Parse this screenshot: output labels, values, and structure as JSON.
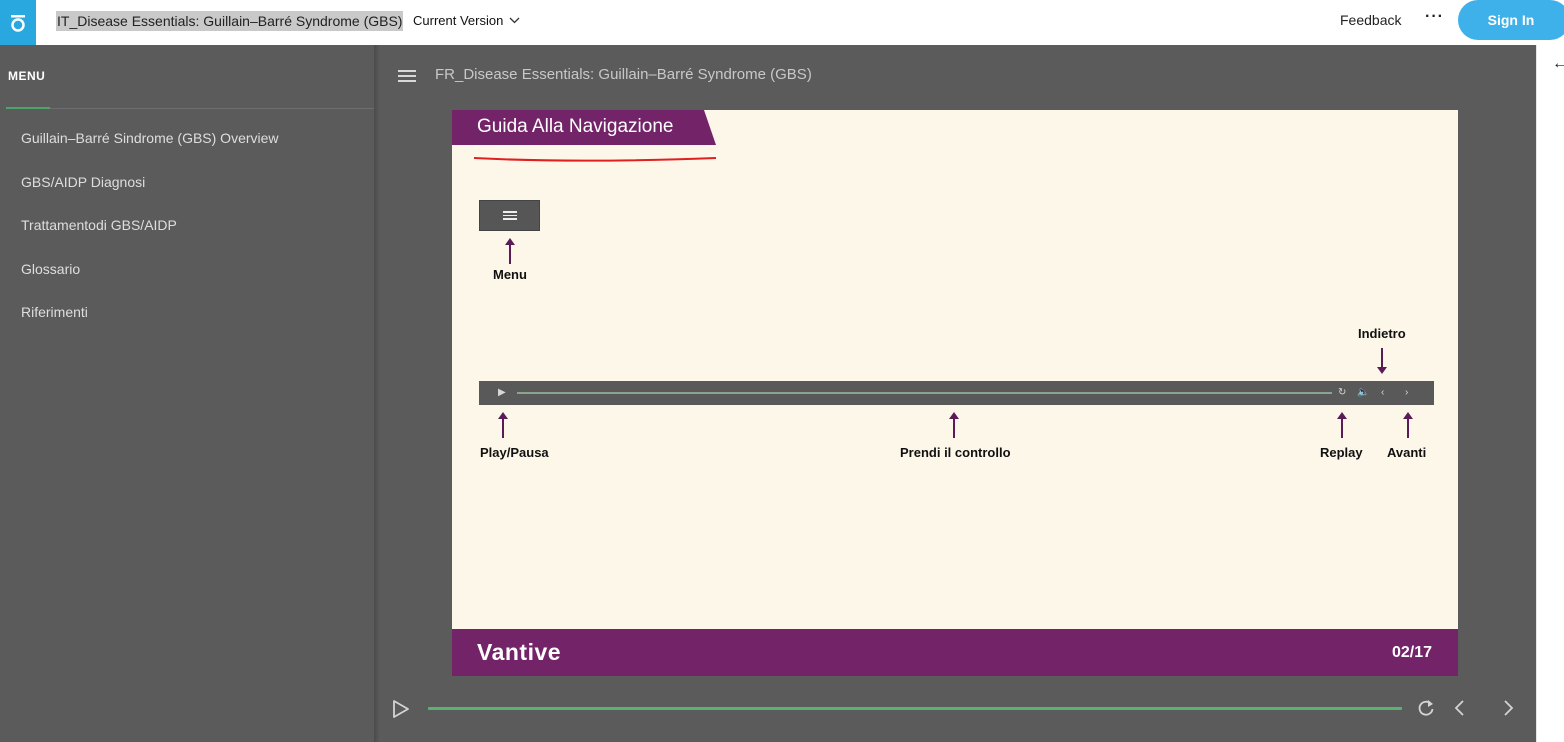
{
  "app": {
    "document_title": "IT_Disease Essentials: Guillain–Barré Syndrome (GBS)",
    "version_label": "Current Version",
    "feedback_label": "Feedback",
    "more_label": "···",
    "signin_label": "Sign In",
    "accent_color": "#29a8e0"
  },
  "sidebar": {
    "heading": "MENU",
    "items": [
      {
        "label": "Guillain–Barré Sindrome (GBS) Overview"
      },
      {
        "label": "GBS/AIDP Diagnosi"
      },
      {
        "label": "Trattamentodi GBS/AIDP"
      },
      {
        "label": "Glossario"
      },
      {
        "label": "Riferimenti"
      }
    ]
  },
  "player": {
    "title": "FR_Disease Essentials: Guillain–Barré Syndrome (GBS)",
    "progress": 1.0
  },
  "slide": {
    "heading": "Guida Alla Navigazione",
    "labels": {
      "menu": "Menu",
      "play_pause": "Play/Pausa",
      "take_control": "Prendi il controllo",
      "replay": "Replay",
      "back": "Indietro",
      "forward": "Avanti"
    },
    "brand": "Vantive",
    "page_number": "02/17",
    "brand_color": "#732468"
  },
  "icons": {
    "logo": "altor-logo-icon",
    "menu": "hamburger-icon",
    "play": "play-icon",
    "replay": "replay-icon",
    "previous": "chevron-left-icon",
    "next": "chevron-right-icon",
    "collapse": "arrow-left-icon"
  }
}
